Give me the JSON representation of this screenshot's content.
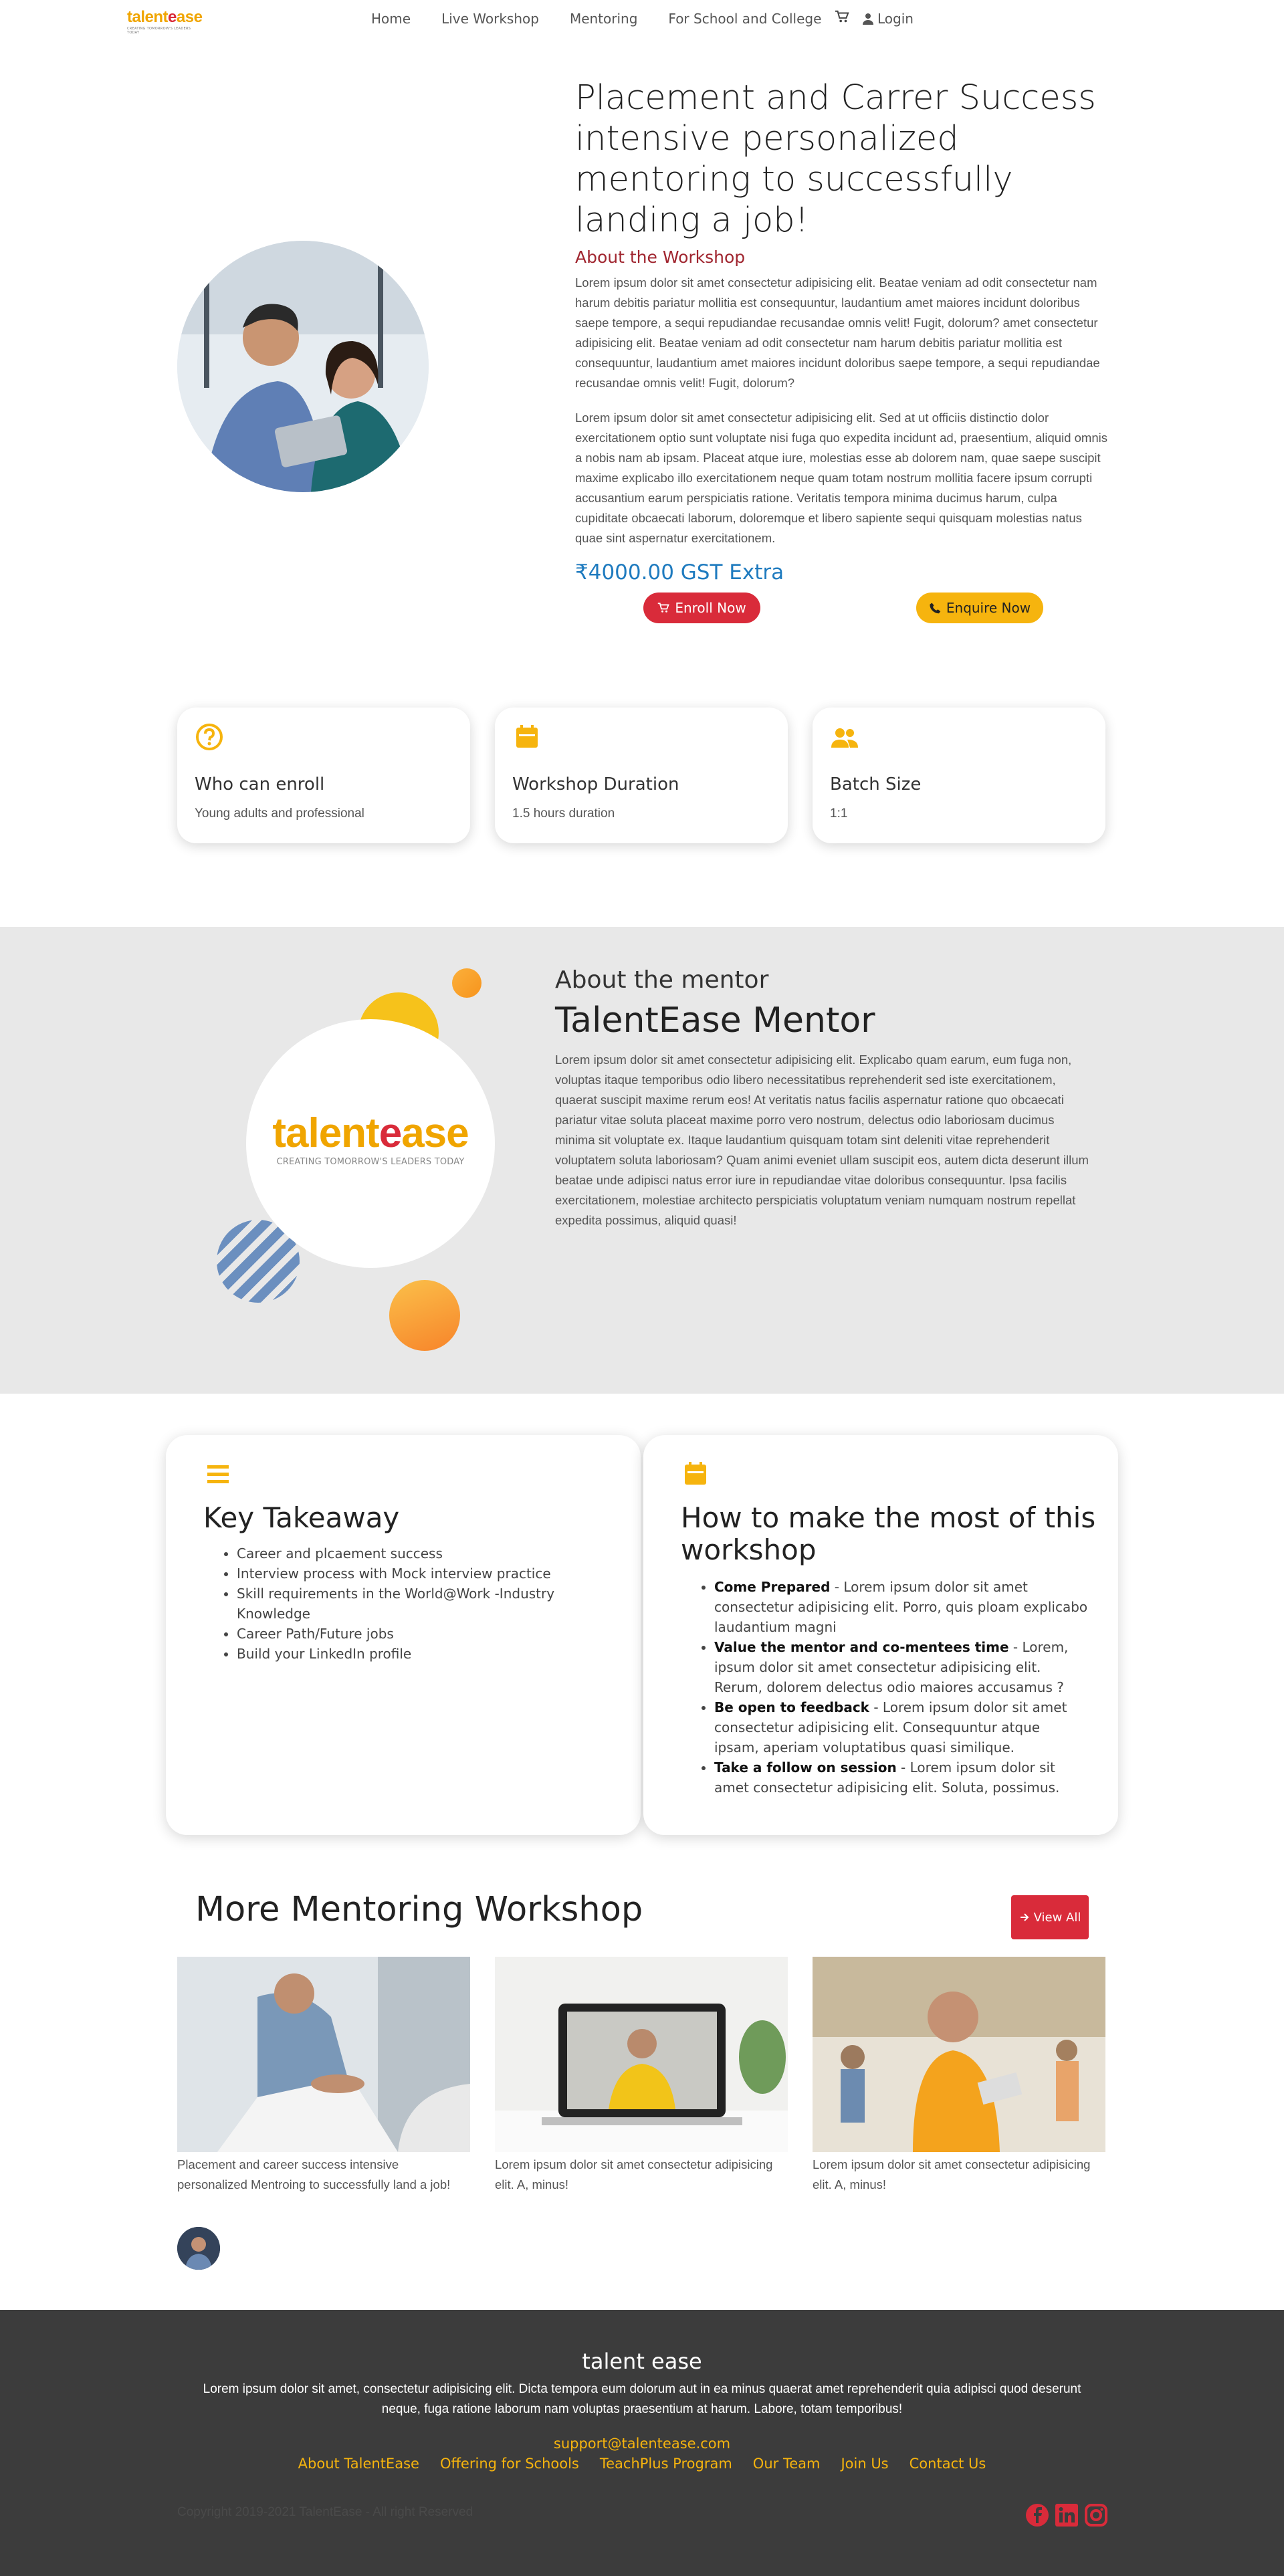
{
  "nav": {
    "logo_text_a": "talent",
    "logo_text_e": "e",
    "logo_text_b": "ase",
    "logo_tagline": "CREATING TOMORROW'S LEADERS TODAY",
    "links": [
      "Home",
      "Live Workshop",
      "Mentoring",
      "For School and College"
    ],
    "cart_icon": "cart-icon",
    "login_label": "Login"
  },
  "hero": {
    "title": "Placement and Carrer Success intensive personalized mentoring to successfully landing a job!",
    "about_label": "About the Workshop",
    "para1": "Lorem ipsum dolor sit amet consectetur adipisicing elit. Beatae veniam ad odit consectetur nam harum debitis pariatur mollitia est consequuntur, laudantium amet maiores incidunt doloribus saepe tempore, a sequi repudiandae recusandae omnis velit! Fugit, dolorum? amet consectetur adipisicing elit. Beatae veniam ad odit consectetur nam harum debitis pariatur mollitia est consequuntur, laudantium amet maiores incidunt doloribus saepe tempore, a sequi repudiandae recusandae omnis velit! Fugit, dolorum?",
    "para2": "Lorem ipsum dolor sit amet consectetur adipisicing elit. Sed at ut officiis distinctio dolor exercitationem optio sunt voluptate nisi fuga quo expedita incidunt ad, praesentium, aliquid omnis a nobis nam ab ipsam. Placeat atque iure, molestias esse ab dolorem nam, quae saepe suscipit maxime explicabo illo exercitationem neque quam totam nostrum mollitia facere ipsum corrupti accusantium earum perspiciatis ratione. Veritatis tempora minima ducimus harum, culpa cupiditate obcaecati laborum, doloremque et libero sapiente sequi quisquam molestias natus quae sint aspernatur exercitationem.",
    "price": "₹4000.00 GST Extra",
    "enroll_label": "Enroll Now",
    "enquire_label": "Enquire Now"
  },
  "info_cards": [
    {
      "icon": "question-icon",
      "title": "Who can enroll",
      "sub": "Young adults and professional"
    },
    {
      "icon": "calendar-icon",
      "title": "Workshop Duration",
      "sub": "1.5 hours duration"
    },
    {
      "icon": "users-icon",
      "title": "Batch Size",
      "sub": "1:1"
    }
  ],
  "mentor": {
    "logo_text_a": "talent",
    "logo_text_e": "e",
    "logo_text_b": "ase",
    "logo_tagline": "CREATING TOMORROW'S LEADERS TODAY",
    "subtitle": "About the mentor",
    "title": "TalentEase Mentor",
    "para": "Lorem ipsum dolor sit amet consectetur adipisicing elit. Explicabo quam earum, eum fuga non, voluptas itaque temporibus odio libero necessitatibus reprehenderit sed iste exercitationem, quaerat suscipit maxime rerum eos! At veritatis natus facilis aspernatur ratione quo obcaecati pariatur vitae soluta placeat maxime porro vero nostrum, delectus odio laboriosam ducimus minima sit voluptate ex. Itaque laudantium quisquam totam sint deleniti vitae reprehenderit voluptatem soluta laboriosam? Quam animi eveniet ullam suscipit eos, autem dicta deserunt illum beatae unde adipisci natus error iure in repudiandae vitae doloribus consequuntur. Ipsa facilis exercitationem, molestiae architecto perspiciatis voluptatum veniam numquam nostrum repellat expedita possimus, aliquid quasi!"
  },
  "takeaway": {
    "icon": "list-icon",
    "title": "Key Takeaway",
    "items": [
      "Career and plcaement success",
      "Interview process with Mock interview practice",
      "Skill requirements in the World@Work -Industry Knowledge",
      "Career Path/Future jobs",
      "Build your LinkedIn profile"
    ]
  },
  "howto": {
    "icon": "calendar-icon",
    "title": "How to make the most of this workshop",
    "items": [
      {
        "bold": "Come Prepared",
        "text": " - Lorem ipsum dolor sit amet consectetur adipisicing elit. Porro, quis ploam explicabo laudantium magni"
      },
      {
        "bold": "Value the mentor and co-mentees time",
        "text": " - Lorem, ipsum dolor sit amet consectetur adipisicing elit. Rerum, dolorem delectus odio maiores accusamus ?"
      },
      {
        "bold": "Be open to feedback",
        "text": " - Lorem ipsum dolor sit amet consectetur adipisicing elit. Consequuntur atque ipsam, aperiam voluptatibus quasi similique."
      },
      {
        "bold": "Take a follow on session",
        "text": " - Lorem ipsum dolor sit amet consectetur adipisicing elit. Soluta, possimus."
      }
    ]
  },
  "more": {
    "title": "More Mentoring Workshop",
    "view_all": "View All",
    "items": [
      {
        "caption": "Placement and career success intensive personalized Mentroing to successfully land a job!"
      },
      {
        "caption": "Lorem ipsum dolor sit amet consectetur adipisicing elit. A, minus!"
      },
      {
        "caption": "Lorem ipsum dolor sit amet consectetur adipisicing elit. A, minus!"
      }
    ]
  },
  "footer": {
    "title": "talent ease",
    "para": "Lorem ipsum dolor sit amet, consectetur adipisicing elit. Dicta tempora eum dolorum aut in ea minus quaerat amet reprehenderit quia adipisci quod deserunt neque, fuga ratione laborum nam voluptas praesentium at harum. Labore, totam temporibus!",
    "email": "support@talentease.com",
    "links": [
      "About TalentEase",
      "Offering for Schools",
      "TeachPlus Program",
      "Our Team",
      "Join Us",
      "Contact Us"
    ],
    "copyright": "Copyright 2019-2021 TalentEase - All right Reserved",
    "social_icons": [
      "facebook-icon",
      "linkedin-icon",
      "instagram-icon"
    ]
  },
  "colors": {
    "brand_yellow": "#f6b40e",
    "brand_red": "#d92b3a",
    "price_blue": "#1f7bbf",
    "footer_bg": "#3c3c3c",
    "mentor_bg": "#e8e8e8"
  }
}
